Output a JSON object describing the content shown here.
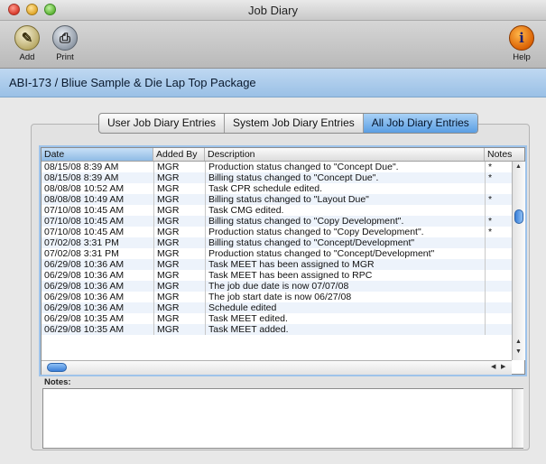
{
  "window": {
    "title": "Job Diary"
  },
  "toolbar": {
    "add": {
      "label": "Add",
      "icon": "pencil-icon"
    },
    "print": {
      "label": "Print",
      "icon": "printer-icon"
    },
    "help": {
      "label": "Help",
      "icon": "info-icon"
    }
  },
  "job_header": "ABI-173 / Bliue Sample & Die Lap Top Package",
  "tabs": [
    {
      "label": "User Job Diary Entries",
      "selected": false
    },
    {
      "label": "System Job Diary Entries",
      "selected": false
    },
    {
      "label": "All Job Diary Entries",
      "selected": true
    }
  ],
  "table": {
    "columns": [
      "Date",
      "Added By",
      "Description",
      "Notes"
    ],
    "rows": [
      {
        "date": "08/15/08 8:39 AM",
        "added_by": "MGR",
        "description": "Production status changed to \"Concept Due\".",
        "notes": "*"
      },
      {
        "date": "08/15/08 8:39 AM",
        "added_by": "MGR",
        "description": "Billing status changed to \"Concept Due\".",
        "notes": "*"
      },
      {
        "date": "08/08/08 10:52 AM",
        "added_by": "MGR",
        "description": "Task CPR schedule edited.",
        "notes": ""
      },
      {
        "date": "08/08/08 10:49 AM",
        "added_by": "MGR",
        "description": "Billing status changed to \"Layout Due\"",
        "notes": "*"
      },
      {
        "date": "07/10/08 10:45 AM",
        "added_by": "MGR",
        "description": "Task CMG edited.",
        "notes": ""
      },
      {
        "date": "07/10/08 10:45 AM",
        "added_by": "MGR",
        "description": "Billing status changed to \"Copy Development\".",
        "notes": "*"
      },
      {
        "date": "07/10/08 10:45 AM",
        "added_by": "MGR",
        "description": "Production status changed to \"Copy Development\".",
        "notes": "*"
      },
      {
        "date": "07/02/08 3:31 PM",
        "added_by": "MGR",
        "description": "Billing status changed to \"Concept/Development\"",
        "notes": ""
      },
      {
        "date": "07/02/08 3:31 PM",
        "added_by": "MGR",
        "description": "Production status changed to \"Concept/Development\"",
        "notes": ""
      },
      {
        "date": "06/29/08 10:36 AM",
        "added_by": "MGR",
        "description": "Task MEET has been assigned to MGR",
        "notes": ""
      },
      {
        "date": "06/29/08 10:36 AM",
        "added_by": "MGR",
        "description": "Task MEET has been assigned to RPC",
        "notes": ""
      },
      {
        "date": "06/29/08 10:36 AM",
        "added_by": "MGR",
        "description": "The job due date is now 07/07/08",
        "notes": ""
      },
      {
        "date": "06/29/08 10:36 AM",
        "added_by": "MGR",
        "description": "The job start date is now 06/27/08",
        "notes": ""
      },
      {
        "date": "06/29/08 10:36 AM",
        "added_by": "MGR",
        "description": "Schedule edited",
        "notes": ""
      },
      {
        "date": "06/29/08 10:35 AM",
        "added_by": "MGR",
        "description": "Task MEET edited.",
        "notes": ""
      },
      {
        "date": "06/29/08 10:35 AM",
        "added_by": "MGR",
        "description": "Task MEET added.",
        "notes": ""
      }
    ]
  },
  "notes": {
    "label": "Notes:",
    "value": ""
  },
  "colors": {
    "accent": "#5a9ee3",
    "header_band": "#aacbec"
  }
}
